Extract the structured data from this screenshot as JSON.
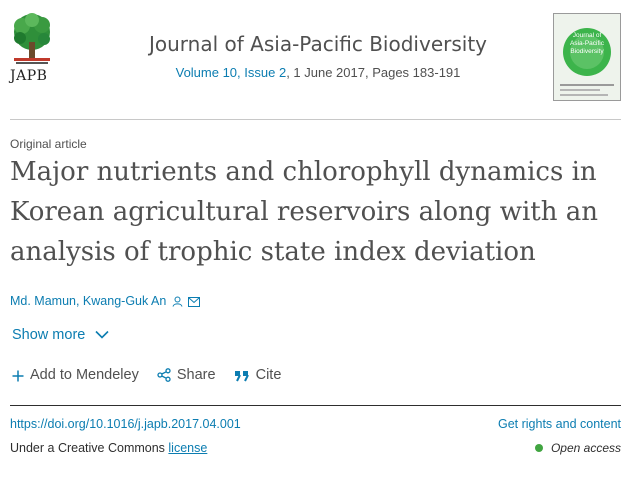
{
  "journal": {
    "logo_text": "JAPB",
    "title": "Journal of Asia-Pacific Biodiversity",
    "volume_link": "Volume 10, Issue 2",
    "date_pages": ", 1 June 2017, Pages 183-191",
    "cover_text": "Journal of Asia-Pacific Biodiversity"
  },
  "article": {
    "type": "Original article",
    "title": "Major nutrients and chlorophyll dynamics in Korean agricultural reservoirs along with an analysis of trophic state index deviation",
    "authors": "Md. Mamun, Kwang-Guk An"
  },
  "show_more": "Show more",
  "actions": {
    "mendeley": "Add to Mendeley",
    "share": "Share",
    "cite": "Cite"
  },
  "footer": {
    "doi": "https://doi.org/10.1016/j.japb.2017.04.001",
    "rights": "Get rights and content",
    "license_prefix": "Under a Creative Commons ",
    "license_link": "license",
    "open_access": "Open access"
  },
  "colors": {
    "link": "#0c7db1",
    "text": "#505050",
    "open_access_dot": "#41a541"
  },
  "icons": [
    "logo-tree-icon",
    "person-icon",
    "envelope-icon",
    "chevron-down-icon",
    "plus-icon",
    "share-icon",
    "quote-icon"
  ]
}
